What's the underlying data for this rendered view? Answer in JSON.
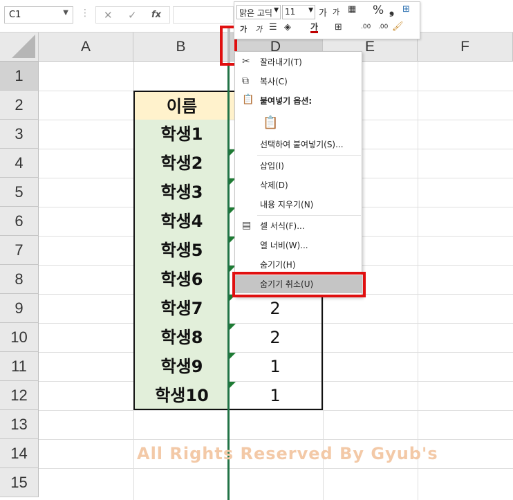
{
  "formula_bar": {
    "name_box": "C1",
    "cancel_glyph": "✕",
    "enter_glyph": "✓",
    "fx_glyph": "fx",
    "formula_value": ""
  },
  "columns": [
    "A",
    "B",
    "D",
    "E",
    "F"
  ],
  "rows": [
    "1",
    "2",
    "3",
    "4",
    "5",
    "6",
    "7",
    "8",
    "9",
    "10",
    "11",
    "12",
    "13",
    "14",
    "15"
  ],
  "table": {
    "header_label": "이름",
    "students": [
      "학생1",
      "학생2",
      "학생3",
      "학생4",
      "학생5",
      "학생6",
      "학생7",
      "학생8",
      "학생9",
      "학생10"
    ],
    "d_values": [
      "",
      "",
      "",
      "",
      "",
      "",
      "2",
      "2",
      "1",
      "1"
    ]
  },
  "mini_toolbar": {
    "font_name": "맑은 고딕",
    "font_size": "11",
    "grow_font": "가",
    "shrink_font": "가",
    "percent": "%",
    "comma": "❟",
    "bold": "가",
    "italic": "가",
    "font_color_glyph": "가",
    "dec_increase": ".00",
    "dec_decrease": ".00"
  },
  "context_menu": {
    "cut": "잘라내기(T)",
    "copy": "복사(C)",
    "paste_options": "붙여넣기 옵션:",
    "paste_special": "선택하여 붙여넣기(S)...",
    "insert": "삽입(I)",
    "delete": "삭제(D)",
    "clear_contents": "내용 지우기(N)",
    "format_cells": "셀 서식(F)...",
    "column_width": "열 너비(W)...",
    "hide": "숨기기(H)",
    "unhide": "숨기기 취소(U)"
  },
  "watermark": "All Rights Reserved By Gyub's",
  "colors": {
    "header_fill": "#fff2cc",
    "student_fill": "#e2efda",
    "highlight_red": "#e01010",
    "excel_green": "#217346"
  },
  "icons": [
    "scissors-icon",
    "copy-icon",
    "paste-icon",
    "clipboard-icon",
    "format-cells-icon",
    "dropdown-icon"
  ]
}
